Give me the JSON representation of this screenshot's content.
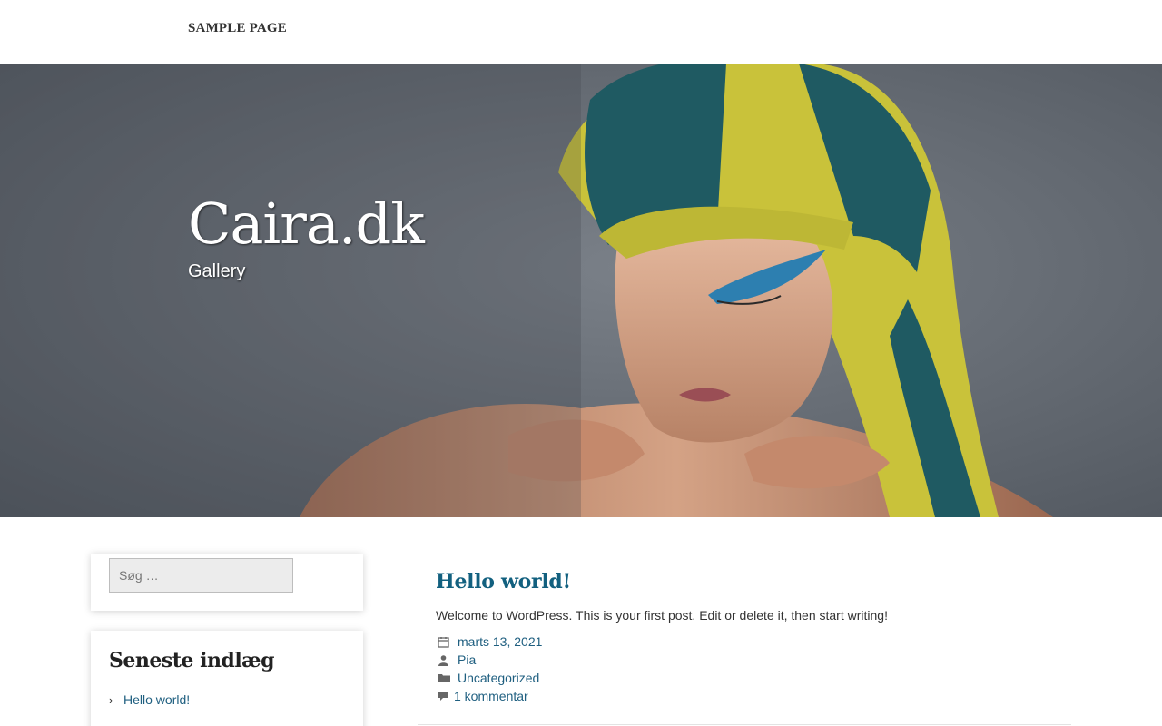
{
  "nav": {
    "sample_page": "SAMPLE PAGE"
  },
  "hero": {
    "site_title": "Caira.dk",
    "tagline": "Gallery"
  },
  "sidebar": {
    "search": {
      "placeholder": "Søg …"
    },
    "recent_posts": {
      "title": "Seneste indlæg",
      "items": [
        {
          "label": "Hello world!"
        }
      ]
    }
  },
  "post": {
    "title": "Hello world!",
    "excerpt": "Welcome to WordPress. This is your first post. Edit or delete it, then start writing!",
    "meta": {
      "date": "marts 13, 2021",
      "author": "Pia",
      "category": "Uncategorized",
      "comments": "1 kommentar"
    }
  },
  "colors": {
    "link": "#1f5f80",
    "title": "#12607f",
    "hero_bg": "#5f656c"
  },
  "icons": {
    "date": "calendar-icon",
    "author": "user-icon",
    "category": "folder-icon",
    "comments": "comment-icon",
    "recent_item": "chevron-right-icon"
  }
}
